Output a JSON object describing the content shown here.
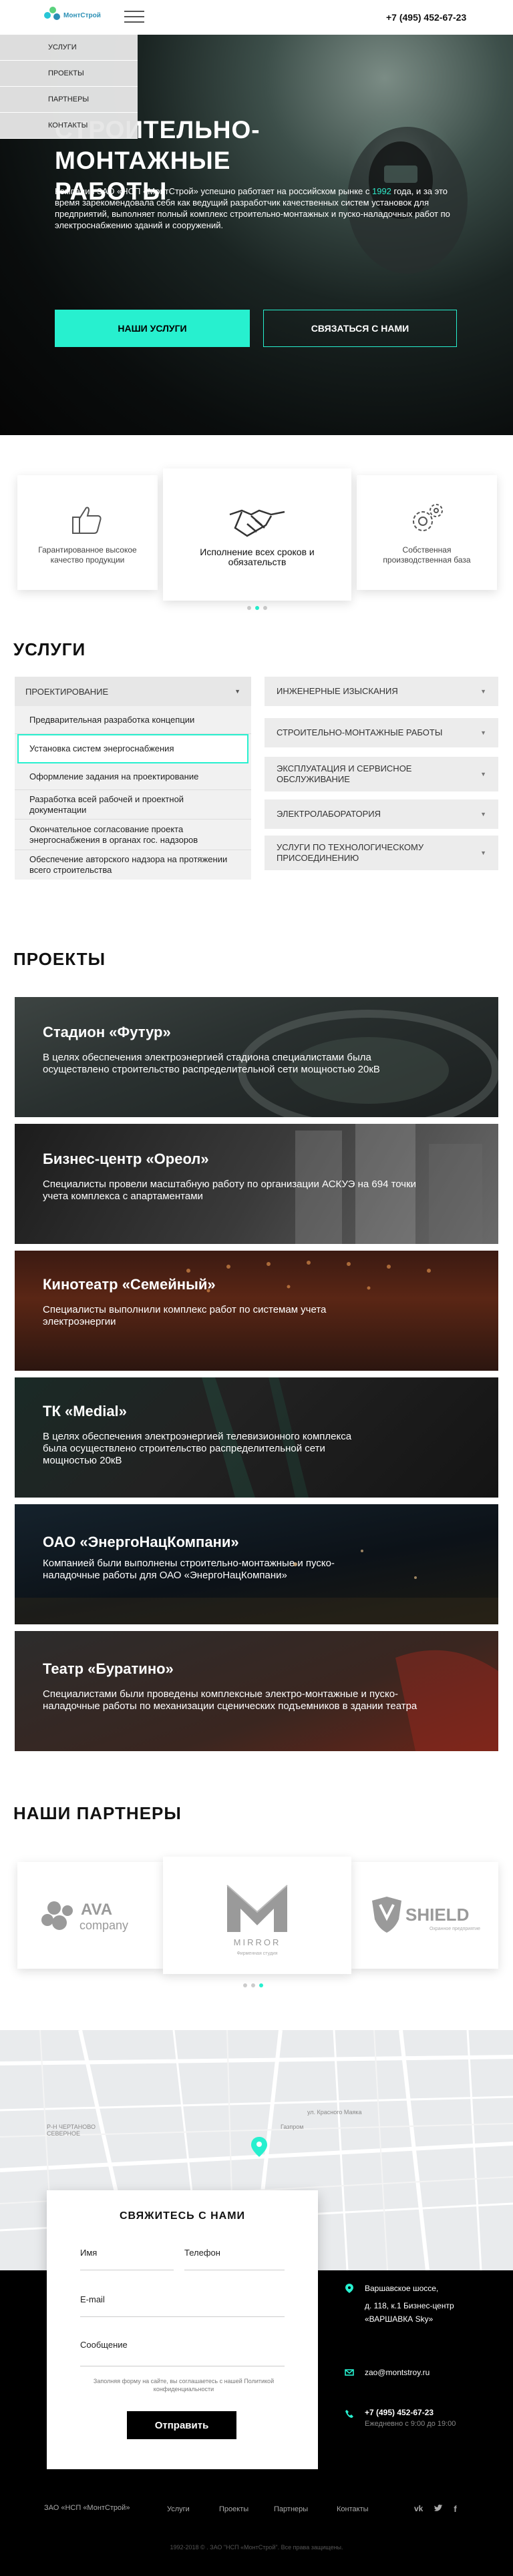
{
  "header": {
    "logo_text": "МонтСтрой",
    "phone": "+7 (495) 452-67-23"
  },
  "menu": {
    "items": [
      {
        "label": "УСЛУГИ"
      },
      {
        "label": "ПРОЕКТЫ"
      },
      {
        "label": "ПАРТНЕРЫ"
      },
      {
        "label": "КОНТАКТЫ"
      }
    ]
  },
  "hero": {
    "title_line1": "СТРОИТЕЛЬНО-МОНТАЖНЫЕ",
    "title_line2": "РАБОТЫ",
    "text_before": "Компания ЗАО «НСП «МонтСтрой» успешно работает на российском рынке с ",
    "text_year": "1992",
    "text_after": " года, и за это время зарекомендовала себя как ведущий разработчик качественных систем установок для предприятий, выполняет полный комплекс строительно-монтажных и пуско-наладочных работ по электроснабжению зданий и сооружений.",
    "btn_services": "НАШИ УСЛУГИ",
    "btn_contact": "СВЯЗАТЬСЯ С НАМИ"
  },
  "features": [
    {
      "text": "Гарантированное высокое качество продукции",
      "icon": "thumbs-up-icon"
    },
    {
      "text": "Исполнение всех сроков и обязательств",
      "icon": "handshake-icon"
    },
    {
      "text": "Собственная производственная база",
      "icon": "gears-icon"
    }
  ],
  "services": {
    "title": "УСЛУГИ",
    "left_head": "ПРОЕКТИРОВАНИЕ",
    "left_items": [
      "Предварительная разработка концепции",
      "Установка систем энергоснабжения",
      "Оформление задания на проектирование",
      "Разработка всей рабочей и проектной документации",
      "Окончательное согласование проекта энергоснабжения в органах гос. надзоров",
      "Обеспечение авторского надзора на протяжении всего строительства"
    ],
    "right_items": [
      "ИНЖЕНЕРНЫЕ ИЗЫСКАНИЯ",
      "СТРОИТЕЛЬНО-МОНТАЖНЫЕ РАБОТЫ",
      "ЭКСПЛУАТАЦИЯ И СЕРВИСНОЕ ОБСЛУЖИВАНИЕ",
      "ЭЛЕКТРОЛАБОРАТОРИЯ",
      "УСЛУГИ ПО ТЕХНОЛОГИЧЕСКОМУ ПРИСОЕДИНЕНИЮ"
    ]
  },
  "projects": {
    "title": "ПРОЕКТЫ",
    "items": [
      {
        "title": "Стадион «Футур»",
        "text": "В целях обеспечения электроэнергией стадиона специалистами была осуществлено строительство распределительной сети мощностью 20кВ"
      },
      {
        "title": "Бизнес-центр «Ореол»",
        "text": "Специалисты провели масштабную работу по организации АСКУЭ на 694 точки учета комплекса с апартаментами"
      },
      {
        "title": "Кинотеатр «Семейный»",
        "text": "Специалисты выполнили комплекс работ по системам учета электроэнергии"
      },
      {
        "title": "ТК «Medial»",
        "text": "В целях обеспечения электроэнергией телевизионного комплекса  была осуществлено строительство распределительной сети мощностью 20кВ"
      },
      {
        "title": "ОАО «ЭнергоНацКомпани»",
        "text": "Компанией были выполнены строительно-монтажные и пуско-наладочные работы для ОАО «ЭнергоНацКомпани»"
      },
      {
        "title": "Театр «Буратино»",
        "text": "Специалистами  были проведены комплексные электро-монтажные и пуско-наладочные работы по механизации сценических подъемников в здании театра"
      }
    ]
  },
  "partners": {
    "title": "НАШИ ПАРТНЕРЫ",
    "items": [
      {
        "name": "AVA company"
      },
      {
        "name": "MIRROR",
        "subtitle": "Фирменная студия"
      },
      {
        "name": "SHIELD",
        "subtitle": "Охранное предприятие"
      }
    ]
  },
  "map": {
    "labels": [
      "Р-Н ЧЕРТАНОВО СЕВЕРНОЕ",
      "ул. Красного Маяка",
      "Газпром"
    ]
  },
  "contact_form": {
    "title": "СВЯЖИТЕСЬ С НАМИ",
    "name_label": "Имя",
    "phone_label": "Телефон",
    "email_label": "E-mail",
    "message_label": "Сообщение",
    "note": "Заполняя форму на сайте, вы соглашаетесь с нашей Политикой конфиденциальности",
    "submit": "Отправить"
  },
  "footer": {
    "address_line1": "Варшавское шоссе,",
    "address_line2": "д. 118, к.1 Бизнес-центр",
    "address_line3": "«ВАРШАВКА Sky»",
    "email": "zao@montstroy.ru",
    "phone": "+7 (495) 452-67-23",
    "hours": "Ежедневно с 9:00 до 19:00",
    "company": "ЗАО «НСП «МонтСтрой»",
    "nav": [
      "Услуги",
      "Проекты",
      "Партнеры",
      "Контакты"
    ],
    "copyright": "1992-2018 © . ЗАО \"НСП «МонтСтрой\". Все права защищены.",
    "social": [
      "vk-icon",
      "twitter-icon",
      "facebook-icon"
    ]
  },
  "colors": {
    "accent": "#27f0cf",
    "dark": "#000000"
  }
}
